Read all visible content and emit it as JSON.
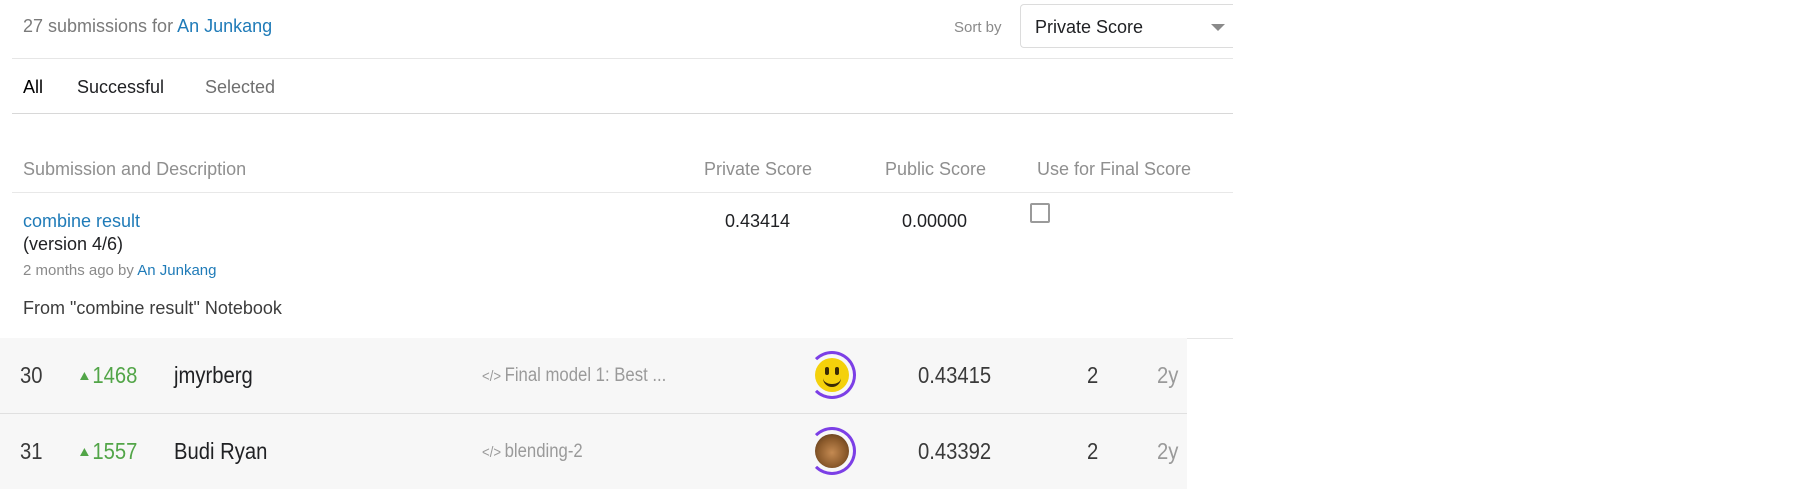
{
  "header": {
    "count_text": "27 submissions for",
    "user_name": "An Junkang",
    "sort_label": "Sort by",
    "sort_value": "Private Score"
  },
  "tabs": [
    "All",
    "Successful",
    "Selected"
  ],
  "columns": {
    "submission": "Submission and Description",
    "private": "Private Score",
    "public": "Public Score",
    "use": "Use for Final Score"
  },
  "submission": {
    "title": "combine result",
    "version": "(version 4/6)",
    "meta_prefix": "2 months ago by",
    "meta_user": "An Junkang",
    "description": "From \"combine result\" Notebook",
    "private_score": "0.43414",
    "public_score": "0.00000",
    "use_for_final": false
  },
  "leaderboard": [
    {
      "rank": "30",
      "delta": "1468",
      "team": "jmyrberg",
      "kernel": "Final model 1: Best ...",
      "score": "0.43415",
      "entries": "2",
      "last": "2y"
    },
    {
      "rank": "31",
      "delta": "1557",
      "team": "Budi Ryan",
      "kernel": "blending-2",
      "score": "0.43392",
      "entries": "2",
      "last": "2y"
    }
  ],
  "icons": {
    "sort_dropdown": "chevron-down-icon",
    "delta": "triangle-up-icon",
    "kernel": "code-icon"
  },
  "colors": {
    "link": "#1f7bb8",
    "delta_up": "#52a548",
    "avatar_ring": "#7c3fe6"
  }
}
